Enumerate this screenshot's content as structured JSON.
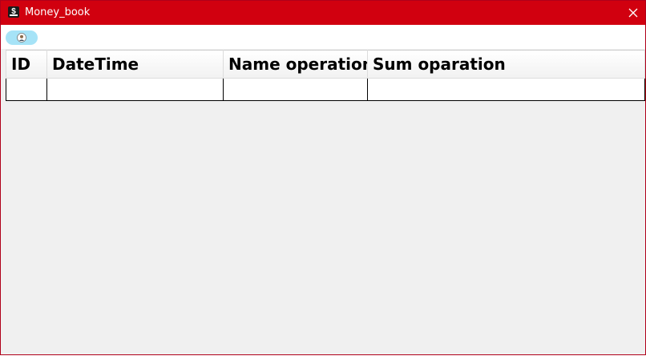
{
  "window": {
    "title": "Money_book",
    "accent_color": "#d1000f"
  },
  "titlebar": {
    "app_icon": "money-book-app-icon",
    "close_icon": "close-icon"
  },
  "toolbar": {
    "profile_icon": "user-profile-icon",
    "profile_button_color": "#a6e3f7"
  },
  "table": {
    "columns": [
      "ID",
      "DateTime",
      "Name operation",
      "Sum oparation"
    ],
    "rows": [
      [
        "",
        "",
        "",
        ""
      ]
    ]
  }
}
